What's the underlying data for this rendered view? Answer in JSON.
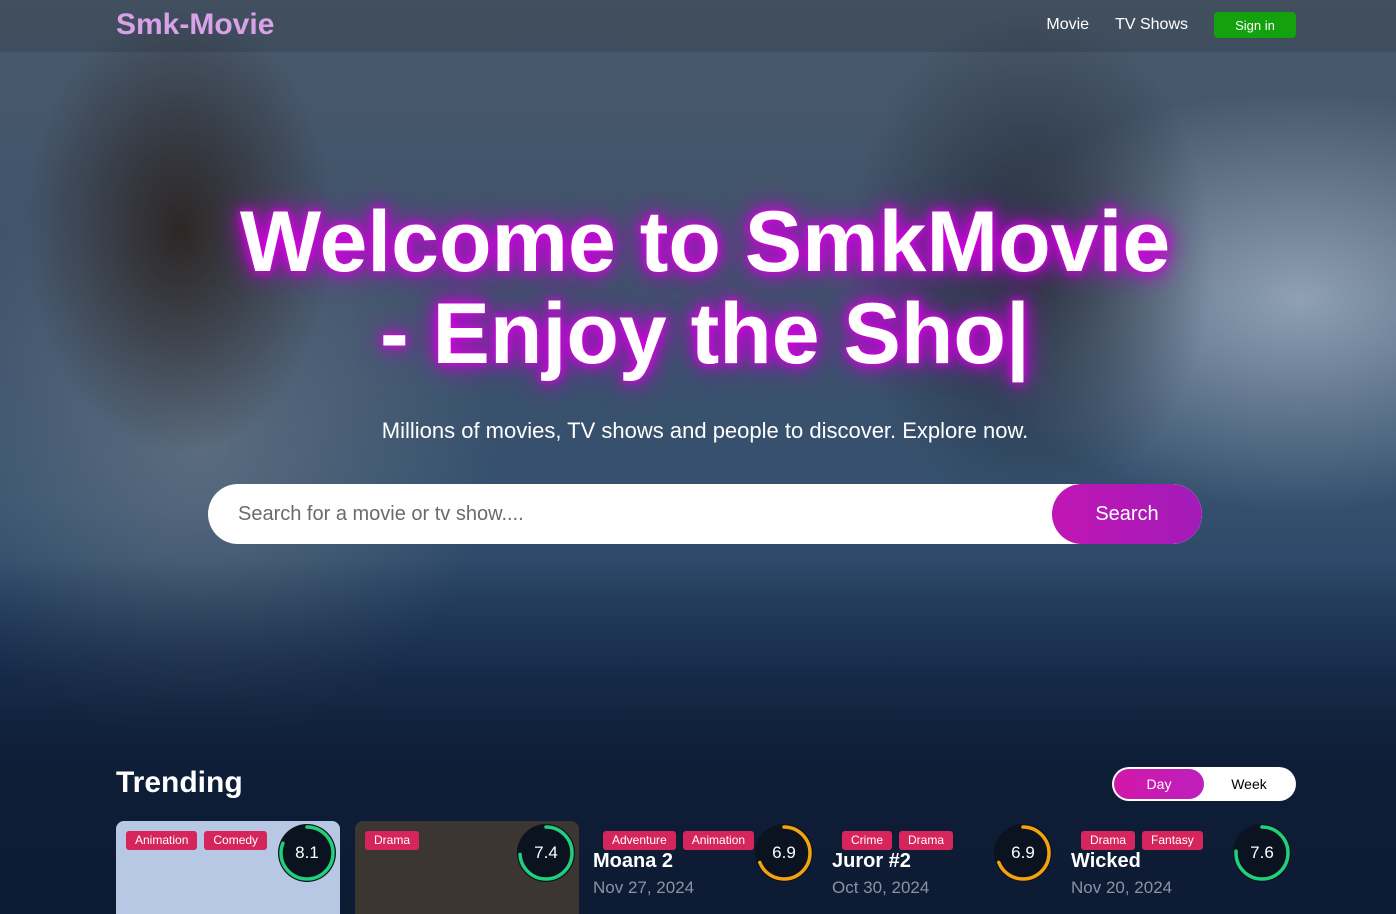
{
  "header": {
    "logo": "Smk-Movie",
    "nav": [
      "Movie",
      "TV Shows"
    ],
    "signin_label": "Sign in"
  },
  "hero": {
    "headline_line1": "Welcome to SmkMovie",
    "headline_line2": "- Enjoy the Sho|",
    "subtitle": "Millions of movies, TV shows and people to discover. Explore now.",
    "search_placeholder": "Search for a movie or tv show....",
    "search_button": "Search"
  },
  "trending": {
    "title": "Trending",
    "toggle": [
      "Day",
      "Week"
    ],
    "active_toggle": "Day",
    "cards": [
      {
        "genres": [
          "Animation",
          "Comedy"
        ],
        "rating": "8.1",
        "score": 0.81,
        "ring_color": "#21d07a",
        "poster": "#b7c8e4",
        "title": "",
        "date": ""
      },
      {
        "genres": [
          "Drama"
        ],
        "rating": "7.4",
        "score": 0.74,
        "ring_color": "#21d07a",
        "poster": "#3b3632",
        "title": "",
        "date": ""
      },
      {
        "genres": [
          "Adventure",
          "Animation"
        ],
        "rating": "6.9",
        "score": 0.69,
        "ring_color": "#f5a30a",
        "poster": "",
        "title": "Moana 2",
        "date": "Nov 27, 2024"
      },
      {
        "genres": [
          "Crime",
          "Drama"
        ],
        "rating": "6.9",
        "score": 0.69,
        "ring_color": "#f5a30a",
        "poster": "",
        "title": "Juror #2",
        "date": "Oct 30, 2024"
      },
      {
        "genres": [
          "Drama",
          "Fantasy"
        ],
        "rating": "7.6",
        "score": 0.76,
        "ring_color": "#21d07a",
        "poster": "",
        "title": "Wicked",
        "date": "Nov 20, 2024"
      }
    ]
  }
}
